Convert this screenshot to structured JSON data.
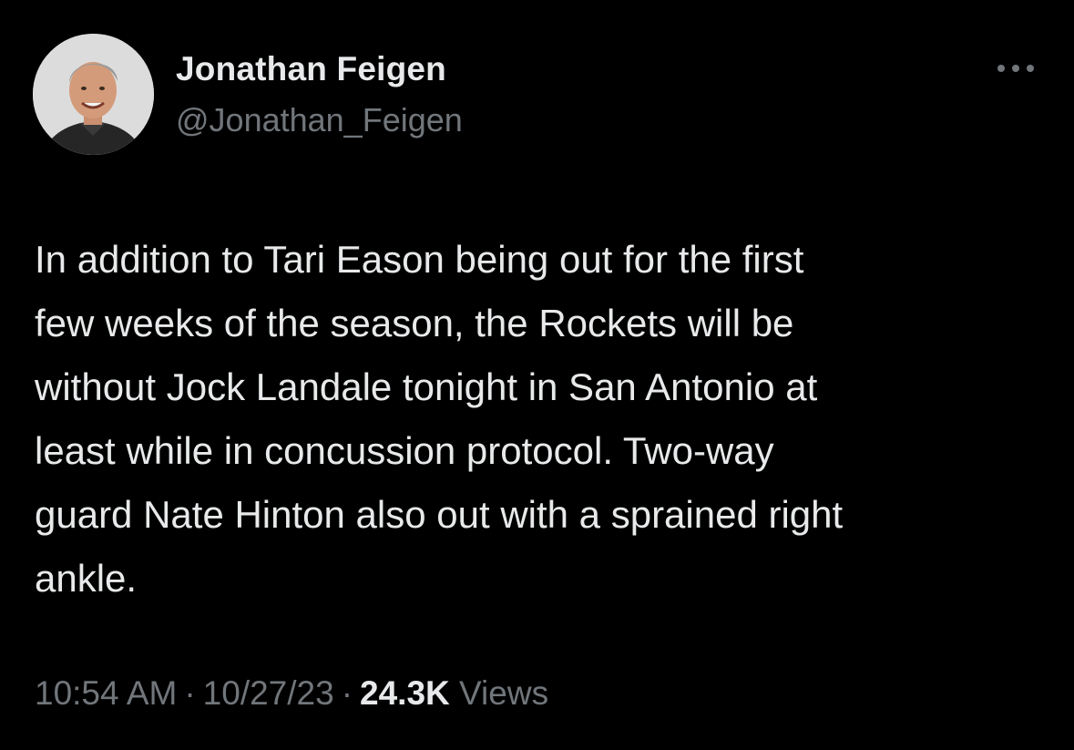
{
  "author": {
    "display_name": "Jonathan Feigen",
    "handle": "@Jonathan_Feigen",
    "avatar_icon": "profile-photo"
  },
  "more_icon": "more-dots-icon",
  "tweet": {
    "lines": [
      "In addition to Tari Eason being out for the first",
      "few weeks of the season, the Rockets will be",
      "without Jock Landale tonight in San Antonio at",
      "least while in concussion protocol. Two-way",
      "guard Nate Hinton also out with a sprained right",
      "ankle."
    ]
  },
  "meta": {
    "time": "10:54 AM",
    "separator": "·",
    "date": "10/27/23",
    "views_count": "24.3K",
    "views_label": "Views"
  },
  "colors": {
    "background": "#000000",
    "primary_text": "#e7e9ea",
    "secondary_text": "#71767b"
  }
}
